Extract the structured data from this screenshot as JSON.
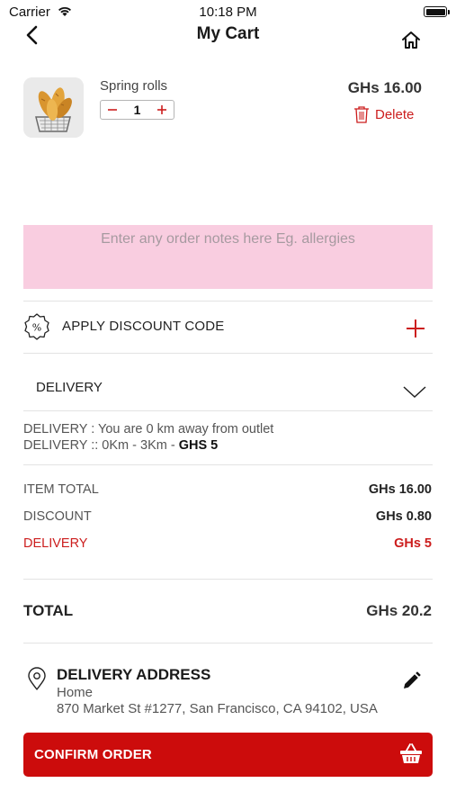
{
  "status_bar": {
    "carrier": "Carrier",
    "time": "10:18 PM"
  },
  "nav": {
    "title": "My Cart"
  },
  "cart_item": {
    "name": "Spring rolls",
    "quantity": "1",
    "price": "GHs 16.00",
    "delete_label": "Delete"
  },
  "notes": {
    "placeholder": "Enter any order notes here Eg. allergies",
    "value": ""
  },
  "discount": {
    "label": "APPLY DISCOUNT CODE"
  },
  "delivery": {
    "selected": "DELIVERY",
    "info_line1": "DELIVERY : You are 0 km away from outlet",
    "info_line2_prefix": "DELIVERY :: 0Km - 3Km - ",
    "info_line2_fee": "GHS 5"
  },
  "totals": {
    "item_total_label": "ITEM TOTAL",
    "item_total_value": "GHs 16.00",
    "discount_label": "DISCOUNT",
    "discount_value": "GHs 0.80",
    "delivery_label": "DELIVERY",
    "delivery_value": "GHs 5",
    "total_label": "TOTAL",
    "total_value": "GHs 20.2"
  },
  "address": {
    "title": "DELIVERY ADDRESS",
    "type": "Home",
    "line": "870 Market St #1277, San Francisco, CA 94102, USA"
  },
  "confirm": {
    "label": "CONFIRM ORDER"
  },
  "colors": {
    "accent_red": "#cc0c0c",
    "notes_bg": "#f9cde0",
    "delete_red": "#cc1d1d"
  },
  "icons": [
    "wifi-icon",
    "battery-icon",
    "back-arrow-icon",
    "home-icon",
    "minus-icon",
    "plus-icon",
    "trash-icon",
    "discount-badge-icon",
    "chevron-down-icon",
    "location-pin-icon",
    "pencil-icon",
    "basket-icon"
  ]
}
